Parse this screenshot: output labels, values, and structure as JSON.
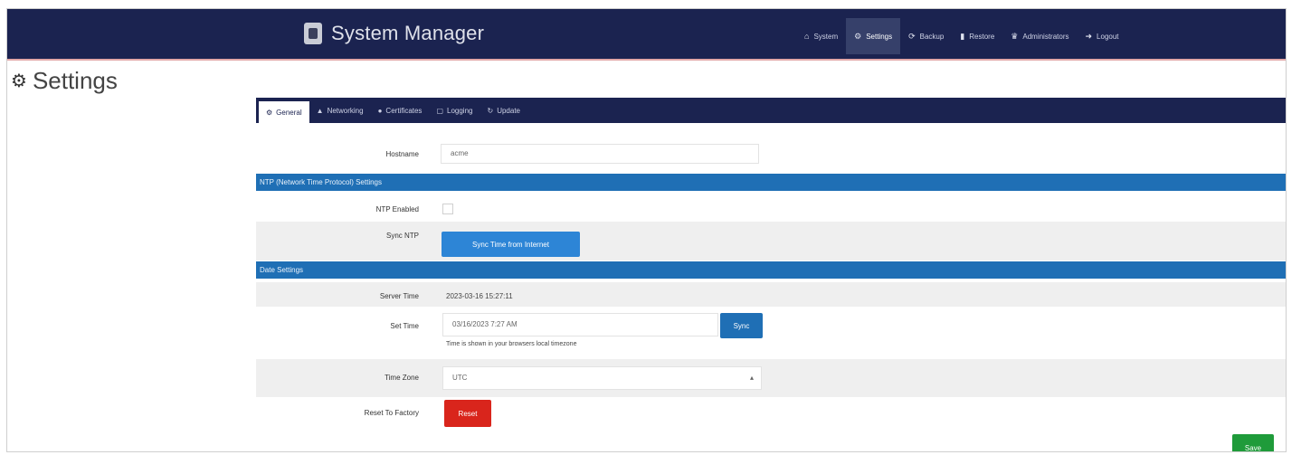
{
  "app": {
    "title": "System Manager",
    "nav": [
      {
        "icon": "⌂",
        "label": "System",
        "active": false
      },
      {
        "icon": "⚙",
        "label": "Settings",
        "active": true
      },
      {
        "icon": "⟳",
        "label": "Backup",
        "active": false
      },
      {
        "icon": "▮",
        "label": "Restore",
        "active": false
      },
      {
        "icon": "♛",
        "label": "Administrators",
        "active": false
      },
      {
        "icon": "➜",
        "label": "Logout",
        "active": false
      }
    ]
  },
  "page": {
    "title": "Settings",
    "title_icon": "⚙"
  },
  "tabs": [
    {
      "icon": "⚙",
      "label": "General",
      "active": true
    },
    {
      "icon": "▲",
      "label": "Networking",
      "active": false
    },
    {
      "icon": "●",
      "label": "Certificates",
      "active": false
    },
    {
      "icon": "▢",
      "label": "Logging",
      "active": false
    },
    {
      "icon": "↻",
      "label": "Update",
      "active": false
    }
  ],
  "general": {
    "hostname_label": "Hostname",
    "hostname_value": "acme",
    "ntp_section": "NTP (Network Time Protocol) Settings",
    "ntp_enabled_label": "NTP Enabled",
    "ntp_enabled": false,
    "sync_ntp_label": "Sync NTP",
    "sync_ntp_button": "Sync Time from Internet",
    "date_section": "Date Settings",
    "server_time_label": "Server Time",
    "server_time_value": "2023-03-16 15:27:11",
    "set_time_label": "Set Time",
    "set_time_value": "03/16/2023 7:27 AM",
    "sync_button": "Sync",
    "set_time_help": "Time is shown in your browsers local timezone",
    "time_zone_label": "Time Zone",
    "time_zone_value": "UTC",
    "reset_label": "Reset To Factory",
    "reset_button": "Reset",
    "save_button": "Save"
  },
  "colors": {
    "navbar": "#1b2350",
    "section_header": "#1f6fb5",
    "danger": "#d9251c",
    "success": "#1f9b3a"
  }
}
